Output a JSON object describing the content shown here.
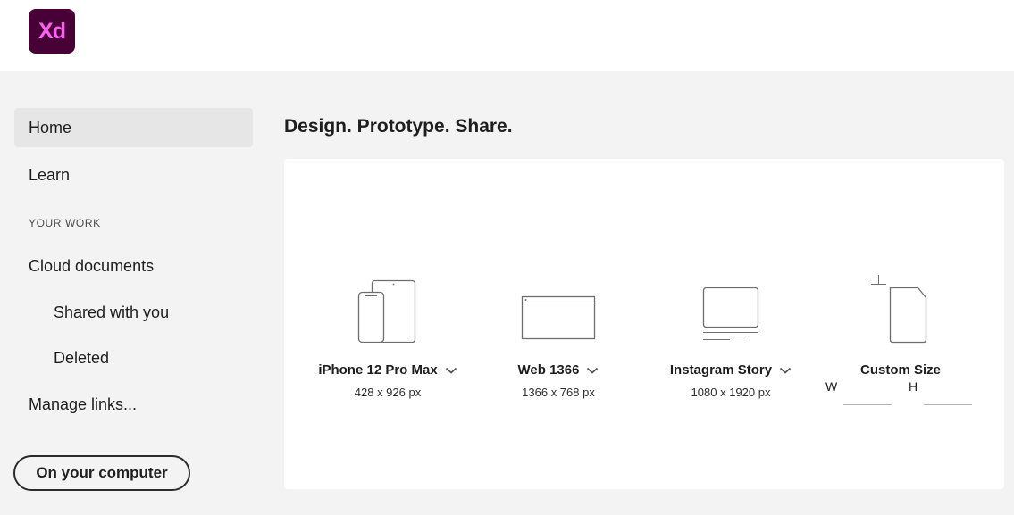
{
  "app": {
    "logo_text": "Xd",
    "logo_bg": "#470137",
    "logo_fg": "#ff61f6"
  },
  "sidebar": {
    "home": "Home",
    "learn": "Learn",
    "section_label": "YOUR WORK",
    "cloud_documents": "Cloud documents",
    "shared_with_you": "Shared with you",
    "deleted": "Deleted",
    "manage_links": "Manage links...",
    "on_your_computer": "On your computer"
  },
  "main": {
    "headline": "Design. Prototype. Share.",
    "presets": [
      {
        "name": "iPhone 12 Pro Max",
        "size": "428 x 926 px",
        "icon": "phone-tablet-icon",
        "has_dropdown": true
      },
      {
        "name": "Web 1366",
        "size": "1366 x 768 px",
        "icon": "web-browser-icon",
        "has_dropdown": true
      },
      {
        "name": "Instagram Story",
        "size": "1080 x 1920 px",
        "icon": "monitor-icon",
        "has_dropdown": true
      },
      {
        "name": "Custom Size",
        "icon": "custom-document-icon",
        "width_label": "W",
        "height_label": "H",
        "width_value": "",
        "height_value": ""
      }
    ]
  }
}
